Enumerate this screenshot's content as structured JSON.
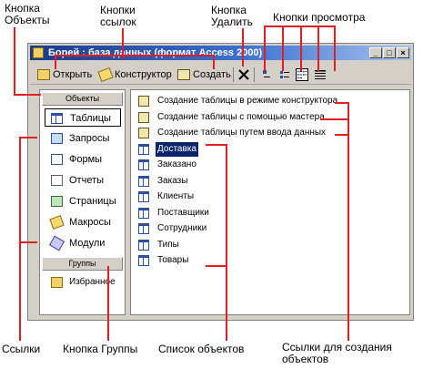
{
  "callouts": {
    "objects_button": "Кнопка\nОбъекты",
    "link_buttons": "Кнопки\nссылок",
    "delete_button": "Кнопка\nУдалить",
    "view_buttons": "Кнопки просмотра",
    "links": "Ссылки",
    "groups_button": "Кнопка Группы",
    "object_list": "Список объектов",
    "create_links": "Ссылки для создания\nобъектов"
  },
  "window": {
    "title": "Борей : база данных (формат Access 2000)",
    "controls": [
      "_",
      "□",
      "×"
    ]
  },
  "toolbar": {
    "open_label": "Открыть",
    "design_label": "Конструктор",
    "create_label": "Создать"
  },
  "sidebar": {
    "objects_header": "Объекты",
    "groups_header": "Группы",
    "items": [
      {
        "label": "Таблицы",
        "icon": "table-icon"
      },
      {
        "label": "Запросы",
        "icon": "query-icon"
      },
      {
        "label": "Формы",
        "icon": "form-icon"
      },
      {
        "label": "Отчеты",
        "icon": "report-icon"
      },
      {
        "label": "Страницы",
        "icon": "page-icon"
      },
      {
        "label": "Макросы",
        "icon": "macro-icon"
      },
      {
        "label": "Модули",
        "icon": "module-icon"
      }
    ],
    "favorites_label": "Избранное"
  },
  "list": {
    "items": [
      {
        "label": "Создание таблицы в режиме конструктора",
        "icon": "wizard-icon"
      },
      {
        "label": "Создание таблицы с помощью мастера",
        "icon": "wizard-icon"
      },
      {
        "label": "Создание таблицы путем ввода данных",
        "icon": "wizard-icon"
      },
      {
        "label": "Доставка",
        "icon": "table-icon"
      },
      {
        "label": "Заказано",
        "icon": "table-icon"
      },
      {
        "label": "Заказы",
        "icon": "table-icon"
      },
      {
        "label": "Клиенты",
        "icon": "table-icon"
      },
      {
        "label": "Поставщики",
        "icon": "table-icon"
      },
      {
        "label": "Сотрудники",
        "icon": "table-icon"
      },
      {
        "label": "Типы",
        "icon": "table-icon"
      },
      {
        "label": "Товары",
        "icon": "table-icon"
      }
    ],
    "selected_index": 3
  },
  "colors": {
    "accent": "#e02020",
    "title_start": "#1b3a8a",
    "title_end": "#a8c4ee",
    "selection": "#0a246a"
  }
}
